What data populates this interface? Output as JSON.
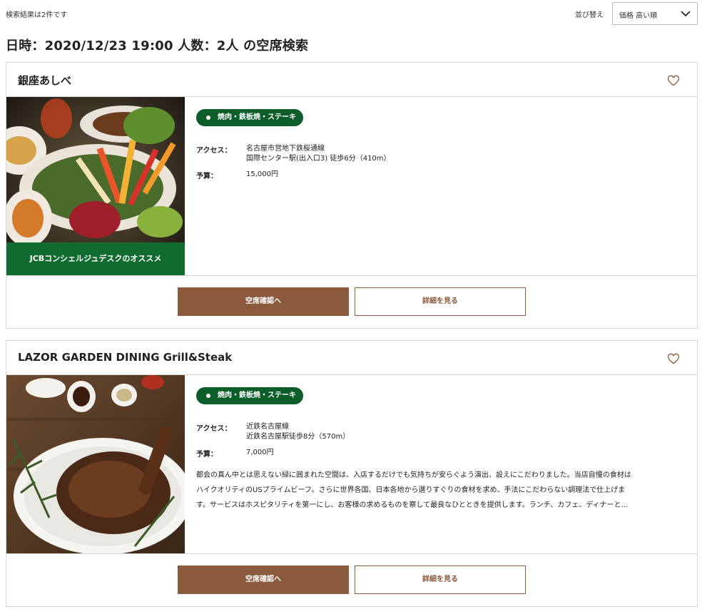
{
  "header": {
    "result_count": "検索結果は2件です",
    "sort_label": "並び替え",
    "sort_value": "価格 高い順",
    "sort_icon": "chevron-down-icon",
    "search_title": "日時：2020/12/23 19:00 人数：2人 の空席検索"
  },
  "colors": {
    "brand_brown": "#8b5a3c",
    "genre_green": "#0b5e2a",
    "photo_band_green": "#0f6b2f"
  },
  "restaurants": [
    {
      "name": "銀座あしべ",
      "favorite_icon": "heart-outline-icon",
      "photo_caption": "JCBコンシェルジュデスクのオススメ",
      "genre": "焼肉・鉄板焼・ステーキ",
      "access_label": "アクセス：",
      "access_line1": "名古屋市営地下鉄桜通線",
      "access_line2": "国際センター駅(出入口3) 徒歩6分（410m）",
      "budget_label": "予算：",
      "budget": "15,000円",
      "check_button": "空席確認へ",
      "detail_button": "詳細を見る"
    },
    {
      "name": "LAZOR GARDEN DINING Grill&Steak",
      "favorite_icon": "heart-outline-icon",
      "genre": "焼肉・鉄板焼・ステーキ",
      "access_label": "アクセス：",
      "access_line1": "近鉄名古屋線",
      "access_line2": "近鉄名古屋駅徒歩8分（570m）",
      "budget_label": "予算：",
      "budget": "7,000円",
      "description_line1": "都会の真ん中とは思えない緑に囲まれた空間は、入店するだけでも気持ちが安らぐよう演出、設えにこだわりました。当店自慢の食材は",
      "description_line2": "ハイクオリティのUSプライムビーフ。さらに世界各国、日本各地から選りすぐりの食材を求め、手法にこだわらない調理法で仕上げま",
      "description_line3": "す。サービスはホスピタリティを第一にし、お客様の求めるものを察して最良なひとときを提供します。ランチ、カフェ、ディナーと…",
      "check_button": "空席確認へ",
      "detail_button": "詳細を見る"
    }
  ]
}
